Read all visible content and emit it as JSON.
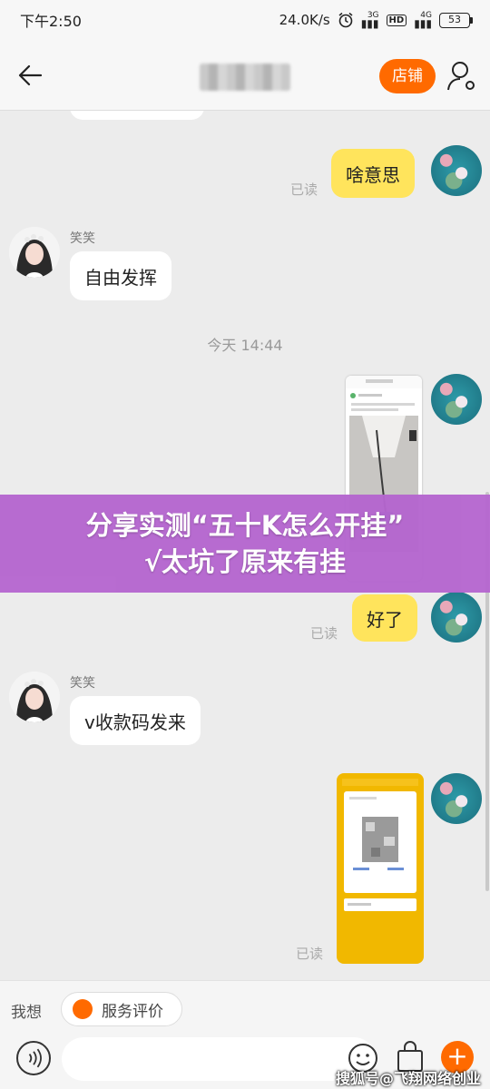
{
  "status_bar": {
    "time": "下午2:50",
    "speed": "24.0K/s",
    "sim1": "3G",
    "sim2": "4G",
    "hd": "HD",
    "battery": "53"
  },
  "nav": {
    "store_label": "店铺"
  },
  "messages": [
    {
      "side": "out",
      "text": "啥意思",
      "read": "已读"
    },
    {
      "side": "in",
      "sender": "笑笑",
      "text": "自由发挥"
    },
    {
      "type": "timestamp",
      "text": "今天  14:44"
    },
    {
      "side": "out",
      "type": "image"
    },
    {
      "side": "out",
      "text": "好了",
      "read": "已读"
    },
    {
      "side": "in",
      "sender": "笑笑",
      "text": "v收款码发来"
    },
    {
      "side": "out",
      "type": "image",
      "read": "已读"
    }
  ],
  "banner": {
    "line1": "分享实测“五十K怎么开挂”",
    "line2": "√太坑了原来有挂"
  },
  "bottom_bar": {
    "want": "我想",
    "service_review": "服务评价",
    "plus": "+"
  },
  "watermark": "搜狐号@飞翔网络创业",
  "colors": {
    "accent": "#ff6a00",
    "bubble_out": "#ffe45c",
    "banner": "#b566cf"
  }
}
